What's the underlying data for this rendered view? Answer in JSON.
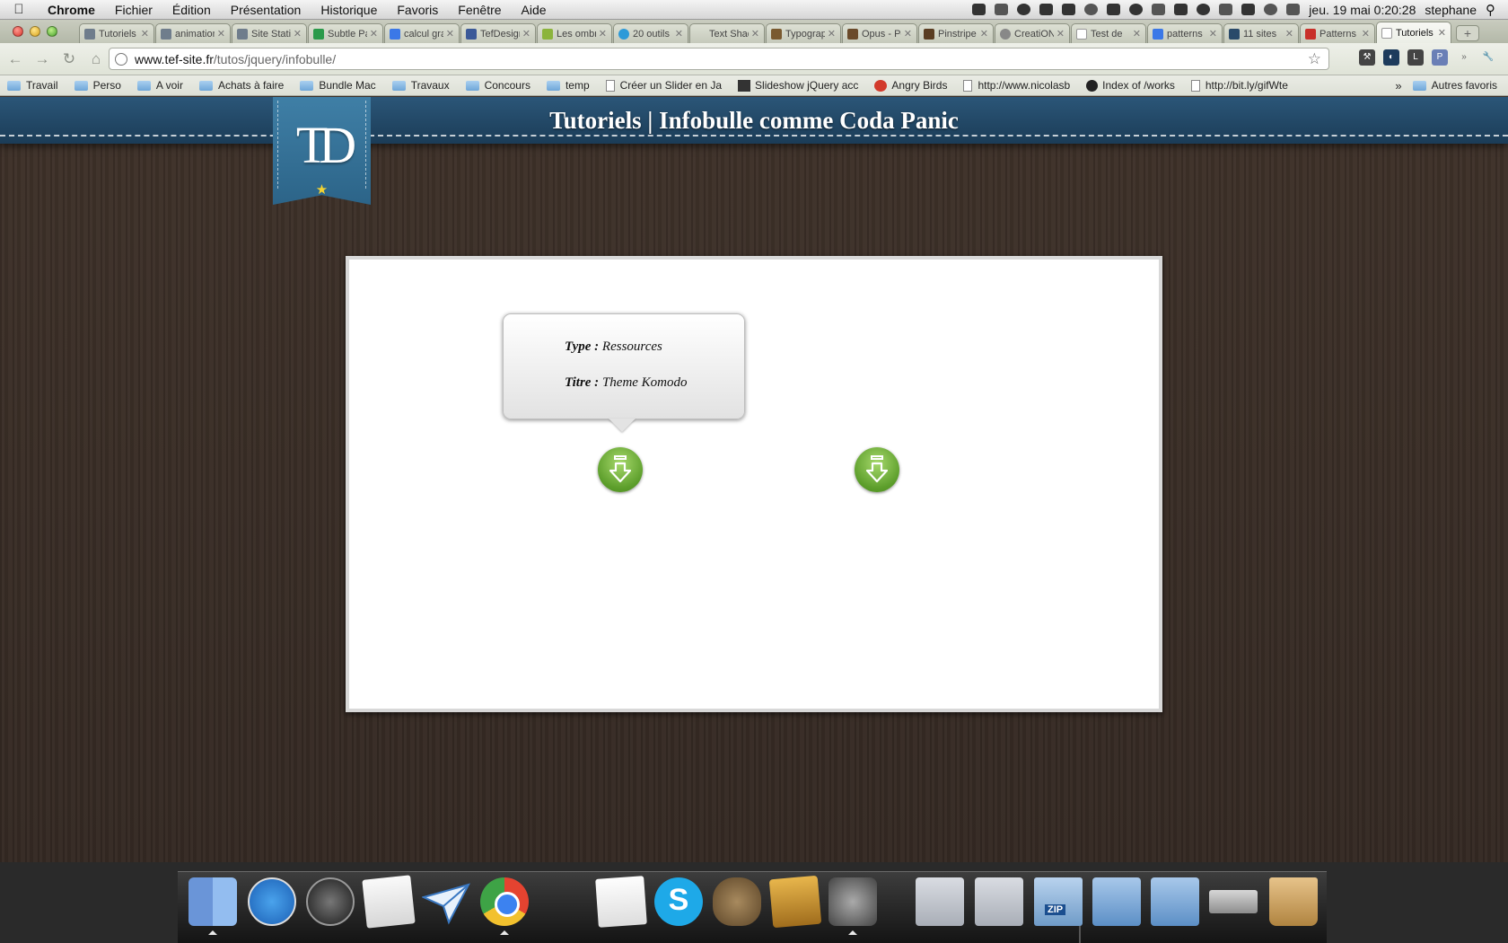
{
  "menubar": {
    "app_name": "Chrome",
    "menus": [
      "Fichier",
      "Édition",
      "Présentation",
      "Historique",
      "Favoris",
      "Fenêtre",
      "Aide"
    ],
    "clock": "jeu. 19 mai  0:20:28",
    "user": "stephane"
  },
  "tabs": [
    {
      "label": "Tutoriels"
    },
    {
      "label": "animation"
    },
    {
      "label": "Site Statique"
    },
    {
      "label": "Subtle Patterns"
    },
    {
      "label": "calcul gratuit"
    },
    {
      "label": "TefDesign"
    },
    {
      "label": "Les ombres"
    },
    {
      "label": "20 outils"
    },
    {
      "label": "Text Shadow"
    },
    {
      "label": "Typographie"
    },
    {
      "label": "Opus - Portfolio"
    },
    {
      "label": "Pinstripe"
    },
    {
      "label": "CreatiON"
    },
    {
      "label": "Test de"
    },
    {
      "label": "patterns"
    },
    {
      "label": "11 sites"
    },
    {
      "label": "Patterns"
    },
    {
      "label": "Tutoriels"
    }
  ],
  "address": {
    "domain": "www.tef-site.fr",
    "path": "/tutos/jquery/infobulle/"
  },
  "bookmarks": [
    {
      "label": "Travail",
      "kind": "folder"
    },
    {
      "label": "Perso",
      "kind": "folder"
    },
    {
      "label": "A voir",
      "kind": "folder"
    },
    {
      "label": "Achats à faire",
      "kind": "folder"
    },
    {
      "label": "Bundle Mac",
      "kind": "folder"
    },
    {
      "label": "Travaux",
      "kind": "folder"
    },
    {
      "label": "Concours",
      "kind": "folder"
    },
    {
      "label": "temp",
      "kind": "folder"
    },
    {
      "label": "Créer un Slider en Ja",
      "kind": "page"
    },
    {
      "label": "Slideshow jQuery acc",
      "kind": "slide"
    },
    {
      "label": "Angry Birds",
      "kind": "bird"
    },
    {
      "label": "http://www.nicolasb",
      "kind": "page"
    },
    {
      "label": "Index of /works",
      "kind": "index"
    },
    {
      "label": "http://bit.ly/gifWte",
      "kind": "page"
    }
  ],
  "bookmarks_more": "»",
  "bookmarks_other": "Autres favoris",
  "site": {
    "title": "Tutoriels | Infobulle comme Coda Panic",
    "logo_text": "TD",
    "logo_star": "★"
  },
  "tooltip": {
    "type_label": "Type :",
    "type_value": "Ressources",
    "title_label": "Titre :",
    "title_value": "Theme Komodo"
  },
  "colors": {
    "header": "#1e4462",
    "download_button": "#6aad33",
    "wood": "#3a2e27",
    "logo_star": "#f3d232"
  },
  "icons": {
    "download": "download-arrow-icon",
    "dock": [
      "finder",
      "app-store",
      "dashboard",
      "mail",
      "airmail",
      "chrome",
      "textedit",
      "skype",
      "night-owl",
      "iphoto",
      "imovie",
      "applications-folder",
      "documents-folder",
      "zip-archive",
      "blue-folder",
      "blue-folder",
      "network-drive",
      "trash"
    ]
  },
  "dock": {
    "zip_label": "ZIP",
    "skype_glyph": "S"
  }
}
